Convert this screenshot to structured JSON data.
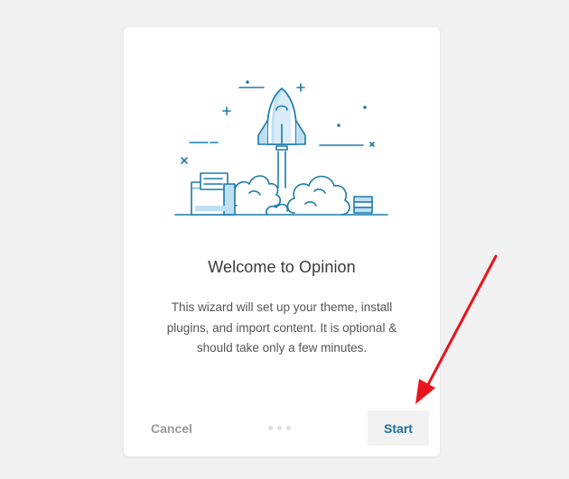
{
  "wizard": {
    "title": "Welcome to Opinion",
    "description": "This wizard will set up your theme, install plugins, and import content. It is optional & should take only a few minutes.",
    "cancel_label": "Cancel",
    "start_label": "Start",
    "step_count": 3,
    "illustration_icon": "rocket-launch-illustration"
  },
  "colors": {
    "background": "#f1f1f1",
    "card": "#ffffff",
    "line_art": "#1a7ba8",
    "line_fill": "#bfe0f3",
    "start_text": "#1e6e9f",
    "cancel_text": "#9a9a9a",
    "annotation_arrow": "#e8141b"
  }
}
